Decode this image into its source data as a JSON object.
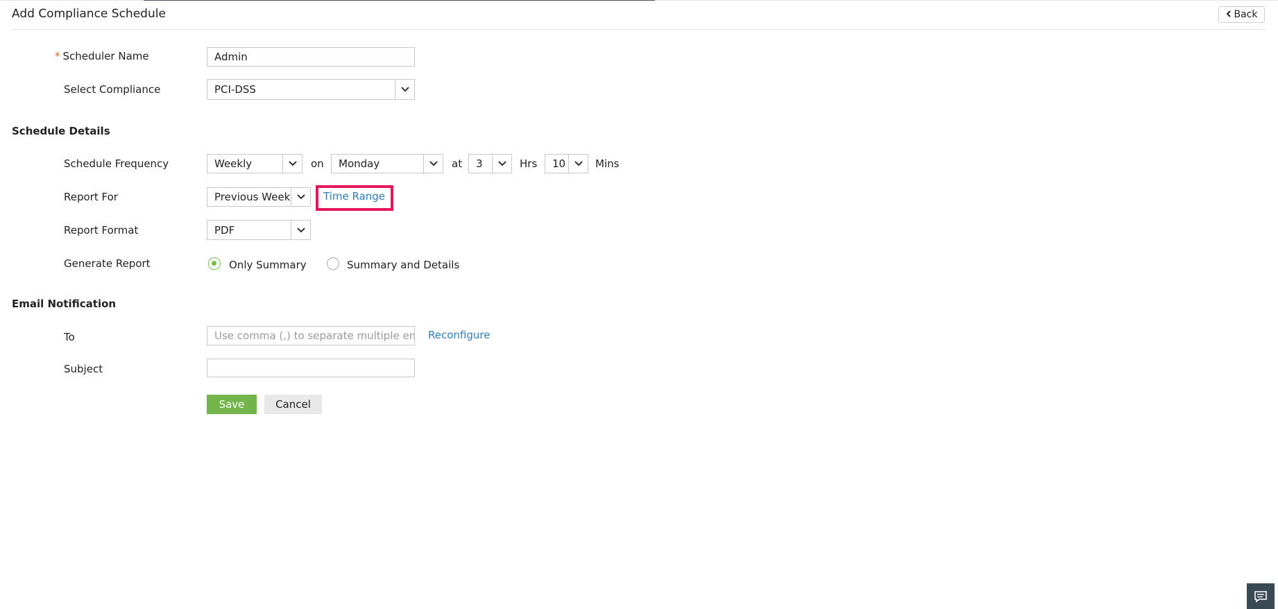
{
  "header": {
    "title": "Add Compliance Schedule",
    "back_label": "Back"
  },
  "form": {
    "scheduler_name": {
      "required_mark": "*",
      "label": "Scheduler Name",
      "value": "Admin"
    },
    "select_compliance": {
      "label": "Select Compliance",
      "value": "PCI-DSS"
    }
  },
  "schedule_details": {
    "heading": "Schedule Details",
    "frequency": {
      "label": "Schedule Frequency",
      "value": "Weekly",
      "on_label": "on",
      "day": "Monday",
      "at_label": "at",
      "hours": "3",
      "hrs_label": "Hrs",
      "minutes": "10",
      "mins_label": "Mins"
    },
    "report_for": {
      "label": "Report For",
      "value": "Previous Week",
      "time_range_link": "Time Range"
    },
    "report_format": {
      "label": "Report Format",
      "value": "PDF"
    },
    "generate_report": {
      "label": "Generate Report",
      "options": [
        "Only Summary",
        "Summary and Details"
      ],
      "selected": "Only Summary"
    }
  },
  "email_notification": {
    "heading": "Email Notification",
    "to": {
      "label": "To",
      "placeholder": "Use comma (,) to separate multiple ema",
      "reconfigure_link": "Reconfigure"
    },
    "subject": {
      "label": "Subject",
      "value": ""
    }
  },
  "actions": {
    "save_label": "Save",
    "cancel_label": "Cancel"
  },
  "colors": {
    "accent_green": "#73b54b",
    "link_blue": "#2e7dbb",
    "highlight_pink": "#e5185c",
    "required_orange": "#e05a1e"
  },
  "icons": {
    "back": "chevron-left-icon",
    "dropdown": "chevron-down-icon",
    "chat": "chat-icon"
  }
}
